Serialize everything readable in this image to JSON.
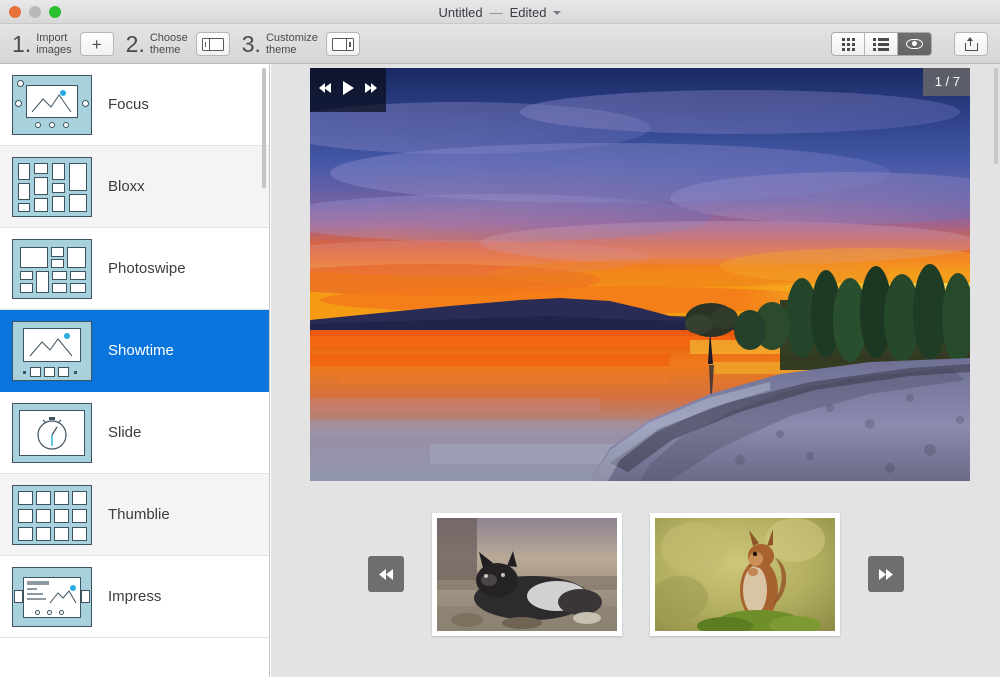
{
  "window": {
    "title": "Untitled",
    "separator": "—",
    "edited_label": "Edited",
    "traffic_lights": [
      "close-button",
      "minimize-button",
      "zoom-button"
    ]
  },
  "toolbar": {
    "steps": [
      {
        "number": "1.",
        "label_line1": "Import",
        "label_line2": "images",
        "button_icon": "plus-icon",
        "button_label": "+"
      },
      {
        "number": "2.",
        "label_line1": "Choose",
        "label_line2": "theme",
        "button_icon": "left-panel-icon",
        "button_label": ""
      },
      {
        "number": "3.",
        "label_line1": "Customize",
        "label_line2": "theme",
        "button_icon": "right-panel-icon",
        "button_label": ""
      }
    ],
    "view_modes": [
      {
        "name": "grid-view",
        "icon": "grid-icon",
        "active": false
      },
      {
        "name": "list-view",
        "icon": "list-icon",
        "active": false
      },
      {
        "name": "preview-view",
        "icon": "eye-icon",
        "active": true
      }
    ],
    "share": {
      "icon": "share-icon",
      "label": ""
    },
    "accent_color": "#0a74dd",
    "active_segment_color": "#6b6b6b"
  },
  "sidebar": {
    "themes": [
      {
        "name": "Focus",
        "selected": false,
        "thumb": "focus-thumb"
      },
      {
        "name": "Bloxx",
        "selected": false,
        "thumb": "bloxx-thumb"
      },
      {
        "name": "Photoswipe",
        "selected": false,
        "thumb": "photoswipe-thumb"
      },
      {
        "name": "Showtime",
        "selected": true,
        "thumb": "showtime-thumb"
      },
      {
        "name": "Slide",
        "selected": false,
        "thumb": "slide-thumb"
      },
      {
        "name": "Thumblie",
        "selected": false,
        "thumb": "thumblie-thumb"
      },
      {
        "name": "Impress",
        "selected": false,
        "thumb": "impress-thumb"
      }
    ],
    "thumb_bg_color": "#a7d1dd",
    "selected_row_color": "#0a74dd"
  },
  "preview": {
    "playback": {
      "rewind": "rewind-icon",
      "play": "play-icon",
      "forward": "fast-forward-icon"
    },
    "counter": "1 / 7",
    "hero_image": "sunset-lake-with-lone-tree-and-poplar-trees",
    "filmstrip": {
      "prev": "prev-icon",
      "next": "next-icon",
      "thumbs": [
        {
          "name": "dog-lying-on-ground-photo"
        },
        {
          "name": "red-squirrel-on-moss-photo"
        }
      ]
    }
  }
}
